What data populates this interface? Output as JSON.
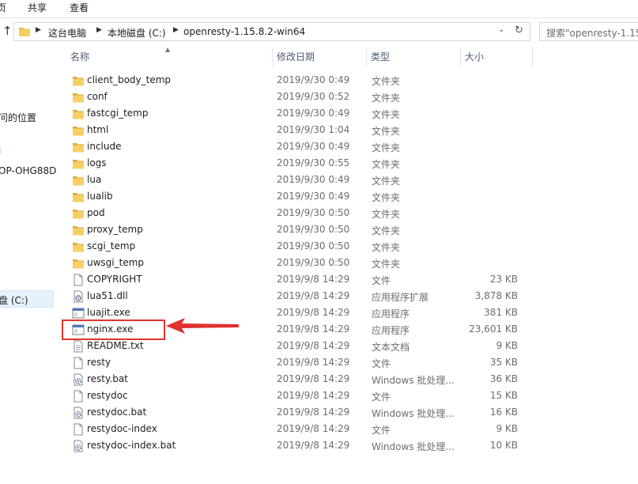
{
  "ribbon": {
    "tabs": [
      "页",
      "共享",
      "查看"
    ]
  },
  "address": {
    "crumbs": [
      "这台电脑",
      "本地磁盘 (C:)",
      "openresty-1.15.8.2-win64"
    ]
  },
  "search": {
    "placeholder": "搜索\"openresty-1.15"
  },
  "nav": {
    "items": [
      "问的位置",
      "i",
      "OP-OHG88D",
      "盘 (C:)"
    ],
    "selected": "盘 (C:)"
  },
  "columns": {
    "name": "名称",
    "date": "修改日期",
    "type": "类型",
    "size": "大小"
  },
  "files": [
    {
      "name": "client_body_temp",
      "date": "2019/9/30 0:49",
      "type": "文件夹",
      "size": "",
      "icon": "folder-icon"
    },
    {
      "name": "conf",
      "date": "2019/9/30 0:52",
      "type": "文件夹",
      "size": "",
      "icon": "folder-icon"
    },
    {
      "name": "fastcgi_temp",
      "date": "2019/9/30 0:49",
      "type": "文件夹",
      "size": "",
      "icon": "folder-icon"
    },
    {
      "name": "html",
      "date": "2019/9/30 1:04",
      "type": "文件夹",
      "size": "",
      "icon": "folder-icon"
    },
    {
      "name": "include",
      "date": "2019/9/30 0:49",
      "type": "文件夹",
      "size": "",
      "icon": "folder-icon"
    },
    {
      "name": "logs",
      "date": "2019/9/30 0:55",
      "type": "文件夹",
      "size": "",
      "icon": "folder-icon"
    },
    {
      "name": "lua",
      "date": "2019/9/30 0:49",
      "type": "文件夹",
      "size": "",
      "icon": "folder-icon"
    },
    {
      "name": "lualib",
      "date": "2019/9/30 0:49",
      "type": "文件夹",
      "size": "",
      "icon": "folder-icon"
    },
    {
      "name": "pod",
      "date": "2019/9/30 0:50",
      "type": "文件夹",
      "size": "",
      "icon": "folder-icon"
    },
    {
      "name": "proxy_temp",
      "date": "2019/9/30 0:50",
      "type": "文件夹",
      "size": "",
      "icon": "folder-icon"
    },
    {
      "name": "scgi_temp",
      "date": "2019/9/30 0:50",
      "type": "文件夹",
      "size": "",
      "icon": "folder-icon"
    },
    {
      "name": "uwsgi_temp",
      "date": "2019/9/30 0:50",
      "type": "文件夹",
      "size": "",
      "icon": "folder-icon"
    },
    {
      "name": "COPYRIGHT",
      "date": "2019/9/8 14:29",
      "type": "文件",
      "size": "23 KB",
      "icon": "file-icon"
    },
    {
      "name": "lua51.dll",
      "date": "2019/9/8 14:29",
      "type": "应用程序扩展",
      "size": "3,878 KB",
      "icon": "dll-icon"
    },
    {
      "name": "luajit.exe",
      "date": "2019/9/8 14:29",
      "type": "应用程序",
      "size": "381 KB",
      "icon": "exe-icon"
    },
    {
      "name": "nginx.exe",
      "date": "2019/9/8 14:29",
      "type": "应用程序",
      "size": "23,601 KB",
      "icon": "exe-icon"
    },
    {
      "name": "README.txt",
      "date": "2019/9/8 14:29",
      "type": "文本文档",
      "size": "9 KB",
      "icon": "text-file-icon"
    },
    {
      "name": "resty",
      "date": "2019/9/8 14:29",
      "type": "文件",
      "size": "35 KB",
      "icon": "file-icon"
    },
    {
      "name": "resty.bat",
      "date": "2019/9/8 14:29",
      "type": "Windows 批处理...",
      "size": "36 KB",
      "icon": "bat-icon"
    },
    {
      "name": "restydoc",
      "date": "2019/9/8 14:29",
      "type": "文件",
      "size": "15 KB",
      "icon": "file-icon"
    },
    {
      "name": "restydoc.bat",
      "date": "2019/9/8 14:29",
      "type": "Windows 批处理...",
      "size": "16 KB",
      "icon": "bat-icon"
    },
    {
      "name": "restydoc-index",
      "date": "2019/9/8 14:29",
      "type": "文件",
      "size": "9 KB",
      "icon": "file-icon"
    },
    {
      "name": "restydoc-index.bat",
      "date": "2019/9/8 14:29",
      "type": "Windows 批处理...",
      "size": "10 KB",
      "icon": "bat-icon"
    }
  ],
  "highlight": {
    "target": "nginx.exe",
    "box_color": "#e0322f",
    "arrow_color": "#e0322f"
  }
}
